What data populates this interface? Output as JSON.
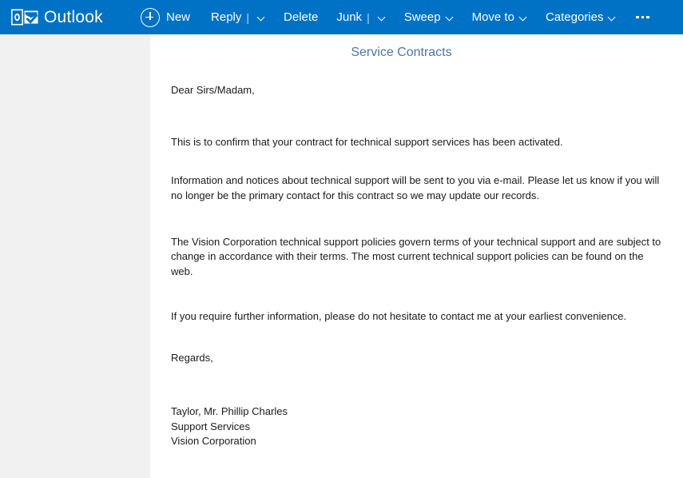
{
  "app": {
    "brand_name": "Outlook",
    "brand_logo_icon": "outlook-logo-icon",
    "accent_color": "#0072c6",
    "sidebar_color": "#f1f1f1",
    "subject_color": "#4a76a8"
  },
  "toolbar": {
    "new": {
      "label": "New",
      "icon": "plus-circle-icon"
    },
    "reply": {
      "label": "Reply",
      "separator": "|",
      "icon": "chevron-down-icon"
    },
    "delete": {
      "label": "Delete"
    },
    "junk": {
      "label": "Junk",
      "separator": "|",
      "icon": "chevron-down-icon"
    },
    "sweep": {
      "label": "Sweep",
      "icon": "chevron-down-icon"
    },
    "move_to": {
      "label": "Move to",
      "icon": "chevron-down-icon"
    },
    "categories": {
      "label": "Categories",
      "icon": "chevron-down-icon"
    },
    "more": {
      "label": "...",
      "icon": "ellipsis-icon"
    }
  },
  "message": {
    "subject": "Service Contracts",
    "salutation": "Dear Sirs/Madam,",
    "paragraph_1": "This is to confirm that your contract for technical support services has been activated.",
    "paragraph_2": "Information and notices about technical support will be sent to you via e-mail. Please let us know if you will no longer be the primary contact for this contract so we may update our records.",
    "paragraph_3": "The Vision Corporation technical support policies govern terms of your technical support and are subject to change in accordance with their terms. The most current technical support policies can be found on the web.",
    "paragraph_4": "If you require further information, please do not hesitate to contact me at your earliest convenience.",
    "closing": "Regards,",
    "signature": {
      "name": "Taylor, Mr. Phillip Charles",
      "department": "Support Services",
      "company": "Vision Corporation"
    }
  }
}
